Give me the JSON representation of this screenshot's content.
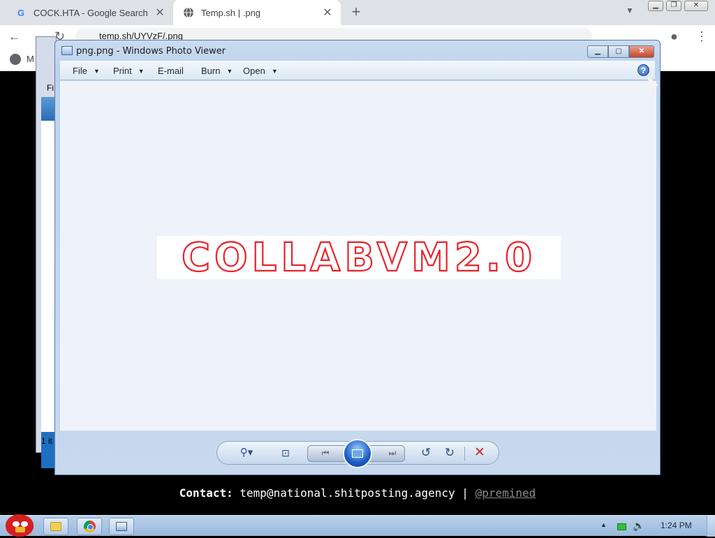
{
  "chrome": {
    "tabs": [
      {
        "title": "COCK.HTA - Google Search",
        "favicon": "google-g-icon"
      },
      {
        "title": "Temp.sh | .png",
        "favicon": "globe-icon"
      }
    ],
    "new_tab": "+",
    "tab_close": "✕",
    "url": "temp.sh/UYVzF/.png",
    "bookmark_label": "M"
  },
  "background_window": {
    "menu_label": "Fi",
    "status_text": "1 it"
  },
  "photo_viewer": {
    "title": "png.png - Windows Photo Viewer",
    "menu": [
      {
        "label": "File",
        "dropdown": true
      },
      {
        "label": "Print",
        "dropdown": true
      },
      {
        "label": "E-mail",
        "dropdown": false
      },
      {
        "label": "Burn",
        "dropdown": true
      },
      {
        "label": "Open",
        "dropdown": true
      }
    ],
    "help_label": "?",
    "image_text": "COLLABVM2.0",
    "image_text_color": "#e8232a",
    "controls": [
      "zoom-icon",
      "actual-size-icon",
      "previous-icon",
      "slideshow-icon",
      "next-icon",
      "rotate-left-icon",
      "rotate-right-icon",
      "delete-icon"
    ]
  },
  "contact": {
    "label": "Contact:",
    "email": "temp@national.shitposting.agency",
    "separator": "|",
    "handle": "@premined"
  },
  "taskbar": {
    "clock": "1:24 PM",
    "pinned": [
      "explorer-icon",
      "chrome-icon",
      "photo-viewer-icon"
    ]
  }
}
